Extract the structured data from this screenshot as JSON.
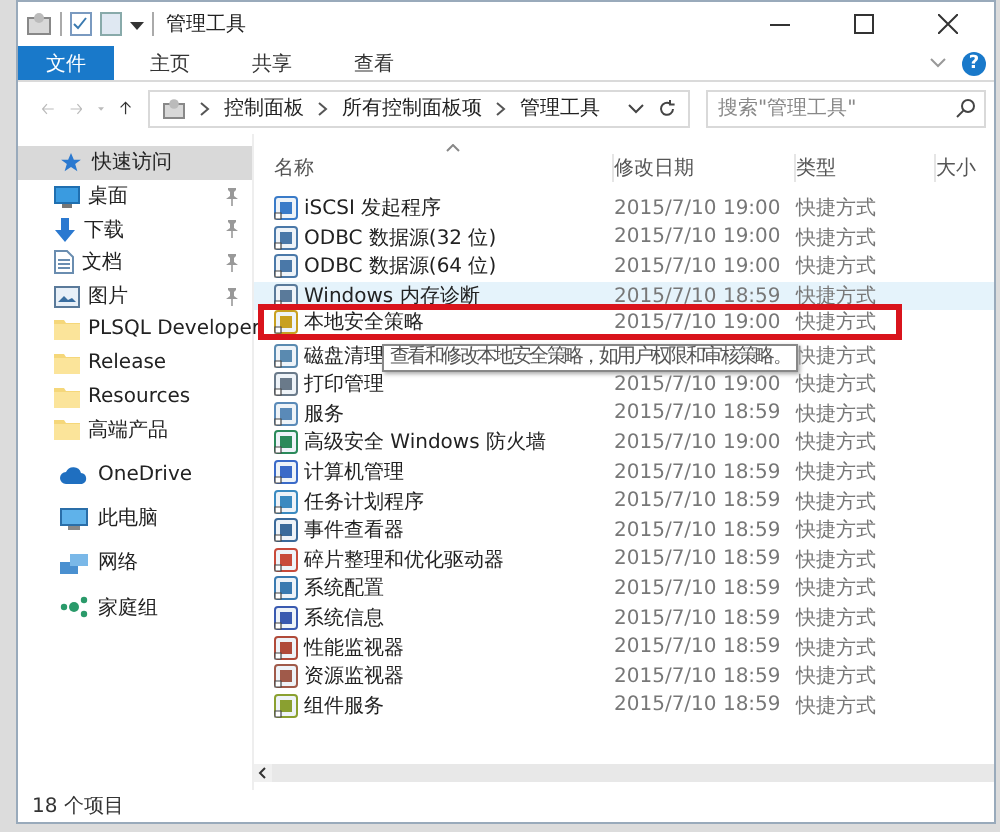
{
  "window": {
    "title": "管理工具"
  },
  "ribbon": {
    "tabs": [
      {
        "label": "文件",
        "selected": true
      },
      {
        "label": "主页",
        "selected": false
      },
      {
        "label": "共享",
        "selected": false
      },
      {
        "label": "查看",
        "selected": false
      }
    ],
    "help": "?"
  },
  "address": {
    "breadcrumbs": [
      "控制面板",
      "所有控制面板项",
      "管理工具"
    ],
    "search": {
      "placeholder": "搜索\"管理工具\""
    }
  },
  "sidebar": {
    "items": [
      {
        "label": "快速访问",
        "kind": "star",
        "selected": true,
        "children": [
          {
            "label": "桌面",
            "kind": "desktop",
            "pinned": true,
            "selected": false
          },
          {
            "label": "下载",
            "kind": "download",
            "pinned": true,
            "selected": false
          },
          {
            "label": "文档",
            "kind": "document",
            "pinned": true,
            "selected": false
          },
          {
            "label": "图片",
            "kind": "picture",
            "pinned": true,
            "selected": false
          },
          {
            "label": "PLSQL Developer",
            "kind": "folder",
            "pinned": false,
            "selected": false
          },
          {
            "label": "Release",
            "kind": "folder",
            "pinned": false,
            "selected": false
          },
          {
            "label": "Resources",
            "kind": "folder",
            "pinned": false,
            "selected": false
          },
          {
            "label": "高端产品",
            "kind": "folder",
            "pinned": false,
            "selected": false
          }
        ]
      },
      {
        "label": "OneDrive",
        "kind": "cloud",
        "selected": false
      },
      {
        "label": "此电脑",
        "kind": "pc",
        "selected": false
      },
      {
        "label": "网络",
        "kind": "network",
        "selected": false
      },
      {
        "label": "家庭组",
        "kind": "homegroup",
        "selected": false
      }
    ]
  },
  "table": {
    "columns": [
      "名称",
      "修改日期",
      "类型",
      "大小"
    ],
    "rows": [
      {
        "name": "iSCSI 发起程序",
        "date": "2015/7/10 19:00",
        "type": "快捷方式",
        "hovered": false,
        "highlighted": false
      },
      {
        "name": "ODBC 数据源(32 位)",
        "date": "2015/7/10 19:00",
        "type": "快捷方式",
        "hovered": false,
        "highlighted": false
      },
      {
        "name": "ODBC 数据源(64 位)",
        "date": "2015/7/10 19:00",
        "type": "快捷方式",
        "hovered": false,
        "highlighted": false
      },
      {
        "name": "Windows 内存诊断",
        "date": "2015/7/10 18:59",
        "type": "快捷方式",
        "hovered": true,
        "highlighted": false
      },
      {
        "name": "本地安全策略",
        "date": "2015/7/10 19:00",
        "type": "快捷方式",
        "hovered": false,
        "highlighted": true,
        "tooltip": "查看和修改本地安全策略，如用户权限和审核策略。"
      },
      {
        "name": "磁盘清理",
        "type": "快捷方式",
        "hovered": false,
        "highlighted": false
      },
      {
        "name": "打印管理",
        "date": "2015/7/10 19:00",
        "type": "快捷方式",
        "hovered": false,
        "highlighted": false
      },
      {
        "name": "服务",
        "date": "2015/7/10 18:59",
        "type": "快捷方式",
        "hovered": false,
        "highlighted": false
      },
      {
        "name": "高级安全 Windows 防火墙",
        "date": "2015/7/10 19:00",
        "type": "快捷方式",
        "hovered": false,
        "highlighted": false
      },
      {
        "name": "计算机管理",
        "date": "2015/7/10 18:59",
        "type": "快捷方式",
        "hovered": false,
        "highlighted": false
      },
      {
        "name": "任务计划程序",
        "date": "2015/7/10 18:59",
        "type": "快捷方式",
        "hovered": false,
        "highlighted": false
      },
      {
        "name": "事件查看器",
        "date": "2015/7/10 18:59",
        "type": "快捷方式",
        "hovered": false,
        "highlighted": false
      },
      {
        "name": "碎片整理和优化驱动器",
        "date": "2015/7/10 18:59",
        "type": "快捷方式",
        "hovered": false,
        "highlighted": false
      },
      {
        "name": "系统配置",
        "date": "2015/7/10 18:59",
        "type": "快捷方式",
        "hovered": false,
        "highlighted": false
      },
      {
        "name": "系统信息",
        "date": "2015/7/10 18:59",
        "type": "快捷方式",
        "hovered": false,
        "highlighted": false
      },
      {
        "name": "性能监视器",
        "date": "2015/7/10 18:59",
        "type": "快捷方式",
        "hovered": false,
        "highlighted": false
      },
      {
        "name": "资源监视器",
        "date": "2015/7/10 18:59",
        "type": "快捷方式",
        "hovered": false,
        "highlighted": false
      },
      {
        "name": "组件服务",
        "date": "2015/7/10 18:59",
        "type": "快捷方式",
        "hovered": false,
        "highlighted": false
      }
    ]
  },
  "status_bar": {
    "count": "18 个项目"
  }
}
